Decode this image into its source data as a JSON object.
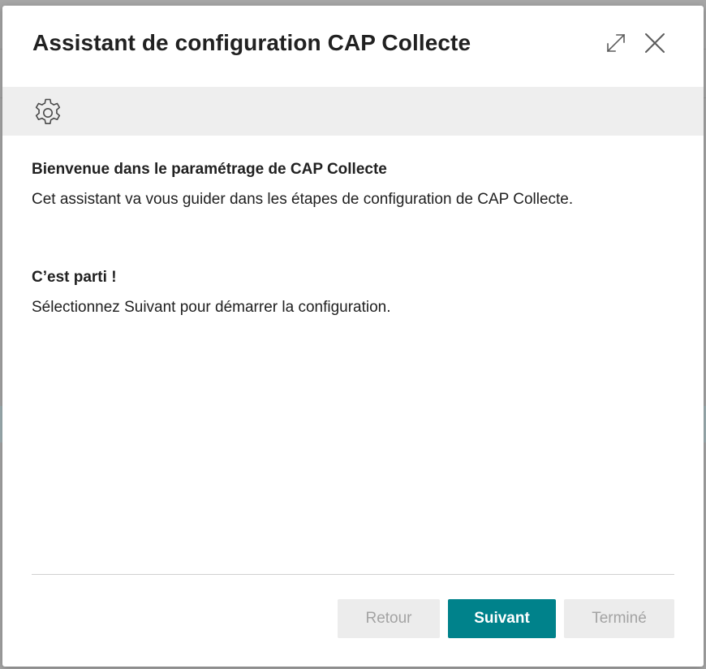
{
  "dialog": {
    "title": "Assistant de configuration CAP Collecte",
    "expand_icon": "expand-icon",
    "close_icon": "close-icon",
    "banner_icon": "gear-icon"
  },
  "content": {
    "welcome_heading": "Bienvenue dans le paramétrage de CAP Collecte",
    "welcome_text": "Cet assistant va vous guider dans les étapes de configuration de CAP Collecte.",
    "start_heading": "C’est parti !",
    "start_text": "Sélectionnez Suivant pour démarrer la configuration."
  },
  "footer": {
    "back_label": "Retour",
    "next_label": "Suivant",
    "finish_label": "Terminé"
  },
  "colors": {
    "accent": "#00828b",
    "disabled_bg": "#ececec",
    "disabled_text": "#a3a3a3",
    "banner_bg": "#eeeeee"
  }
}
